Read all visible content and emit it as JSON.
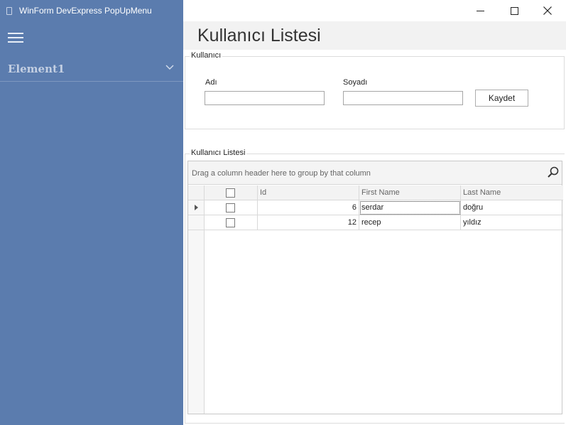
{
  "window": {
    "title": "WinForm DevExpress PopUpMenu",
    "minimize_glyph": "minimize-icon",
    "maximize_glyph": "maximize-icon",
    "close_glyph": "close-icon"
  },
  "sidebar": {
    "menu_icon": "hamburger-icon",
    "groups": [
      {
        "label": "Element1",
        "expand_icon": "chevron-down-icon"
      }
    ]
  },
  "page": {
    "title": "Kullanıcı Listesi"
  },
  "form": {
    "group_caption": "Kullanıcı",
    "first_name_label": "Adı",
    "first_name_value": "",
    "last_name_label": "Soyadı",
    "last_name_value": "",
    "save_label": "Kaydet"
  },
  "grid": {
    "group_caption": "Kullanıcı Listesi",
    "group_panel_text": "Drag a column header here to group by that column",
    "search_icon": "search-icon",
    "columns": [
      "Id",
      "First Name",
      "Last Name"
    ],
    "rows": [
      {
        "checked": false,
        "id": "6",
        "first_name": "serdar",
        "last_name": "doğru"
      },
      {
        "checked": false,
        "id": "12",
        "first_name": "recep",
        "last_name": "yıldız"
      }
    ]
  },
  "colors": {
    "sidebar_bg": "#5b7cae",
    "header_band": "#f2f2f2"
  }
}
